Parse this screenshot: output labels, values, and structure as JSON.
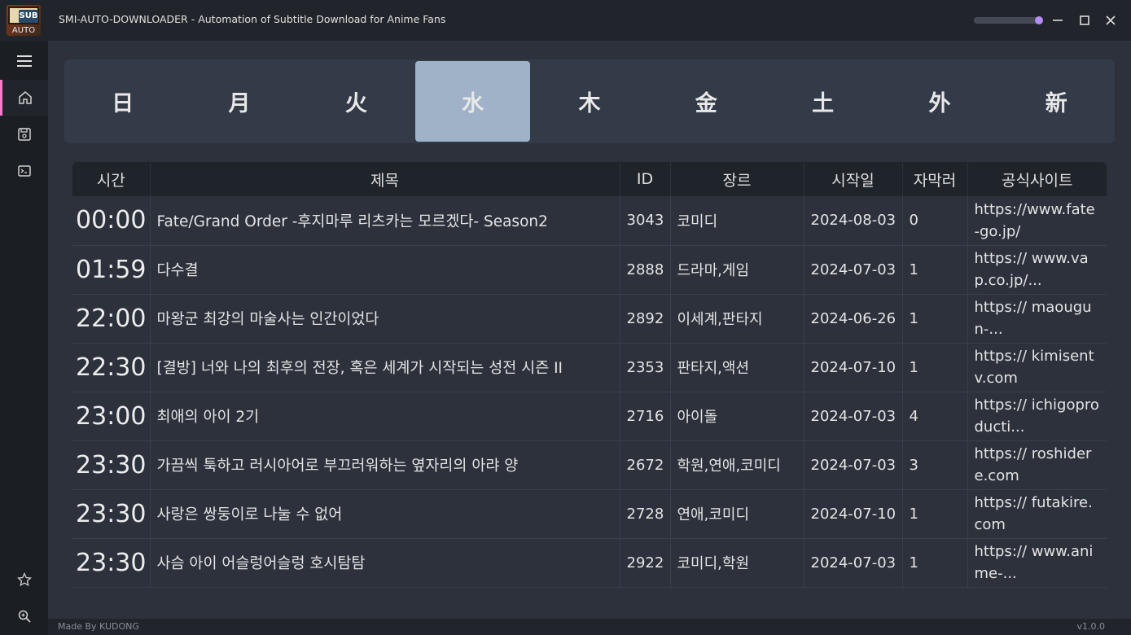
{
  "window": {
    "title": "SMI-AUTO-DOWNLOADER - Automation of Subtitle Download for Anime Fans",
    "logo_badge": "SUB",
    "logo_text": "AUTO",
    "opacity_slider_level": 0.95
  },
  "sidebar": {
    "items": [
      {
        "name": "menu-icon"
      },
      {
        "name": "home-icon",
        "active": true
      },
      {
        "name": "save-icon"
      },
      {
        "name": "terminal-icon"
      },
      {
        "name": "star-icon"
      },
      {
        "name": "zoom-icon"
      }
    ]
  },
  "day_tabs": [
    {
      "label": "日"
    },
    {
      "label": "月"
    },
    {
      "label": "火"
    },
    {
      "label": "水",
      "active": true
    },
    {
      "label": "木"
    },
    {
      "label": "金"
    },
    {
      "label": "土"
    },
    {
      "label": "外"
    },
    {
      "label": "新"
    }
  ],
  "table": {
    "headers": [
      "시간",
      "제목",
      "ID",
      "장르",
      "시작일",
      "자막러",
      "공식사이트"
    ],
    "rows": [
      {
        "time": "00:00",
        "title": "Fate/Grand Order -후지마루 리츠카는 모르겠다- Season2",
        "id": "3043",
        "genre": "코미디",
        "start": "2024-08-03",
        "subs": "0",
        "site": "https://www.fate-go.jp/"
      },
      {
        "time": "01:59",
        "title": "다수결",
        "id": "2888",
        "genre": "드라마,게임",
        "start": "2024-07-03",
        "subs": "1",
        "site": "https:// www.vap.co.jp/..."
      },
      {
        "time": "22:00",
        "title": "마왕군 최강의 마술사는 인간이었다",
        "id": "2892",
        "genre": "이세계,판타지",
        "start": "2024-06-26",
        "subs": "1",
        "site": "https:// maougun-..."
      },
      {
        "time": "22:30",
        "title": "[결방] 너와 나의 최후의 전장, 혹은 세계가 시작되는 성전 시즌 II",
        "id": "2353",
        "genre": "판타지,액션",
        "start": "2024-07-10",
        "subs": "1",
        "site": "https:// kimisentv.com"
      },
      {
        "time": "23:00",
        "title": "최애의 아이 2기",
        "id": "2716",
        "genre": "아이돌",
        "start": "2024-07-03",
        "subs": "4",
        "site": "https:// ichigoproducti..."
      },
      {
        "time": "23:30",
        "title": "가끔씩 툭하고 러시아어로 부끄러워하는 옆자리의 아랴 양",
        "id": "2672",
        "genre": "학원,연애,코미디",
        "start": "2024-07-03",
        "subs": "3",
        "site": "https:// roshidere.com"
      },
      {
        "time": "23:30",
        "title": "사랑은 쌍둥이로 나눌 수 없어",
        "id": "2728",
        "genre": "연애,코미디",
        "start": "2024-07-10",
        "subs": "1",
        "site": "https:// futakire.com"
      },
      {
        "time": "23:30",
        "title": "사슴 아이 어슬렁어슬렁 호시탐탐",
        "id": "2922",
        "genre": "코미디,학원",
        "start": "2024-07-03",
        "subs": "1",
        "site": "https:// www.anime-..."
      }
    ]
  },
  "footer": {
    "credit": "Made By KUDONG",
    "version": "v1.0.0"
  }
}
